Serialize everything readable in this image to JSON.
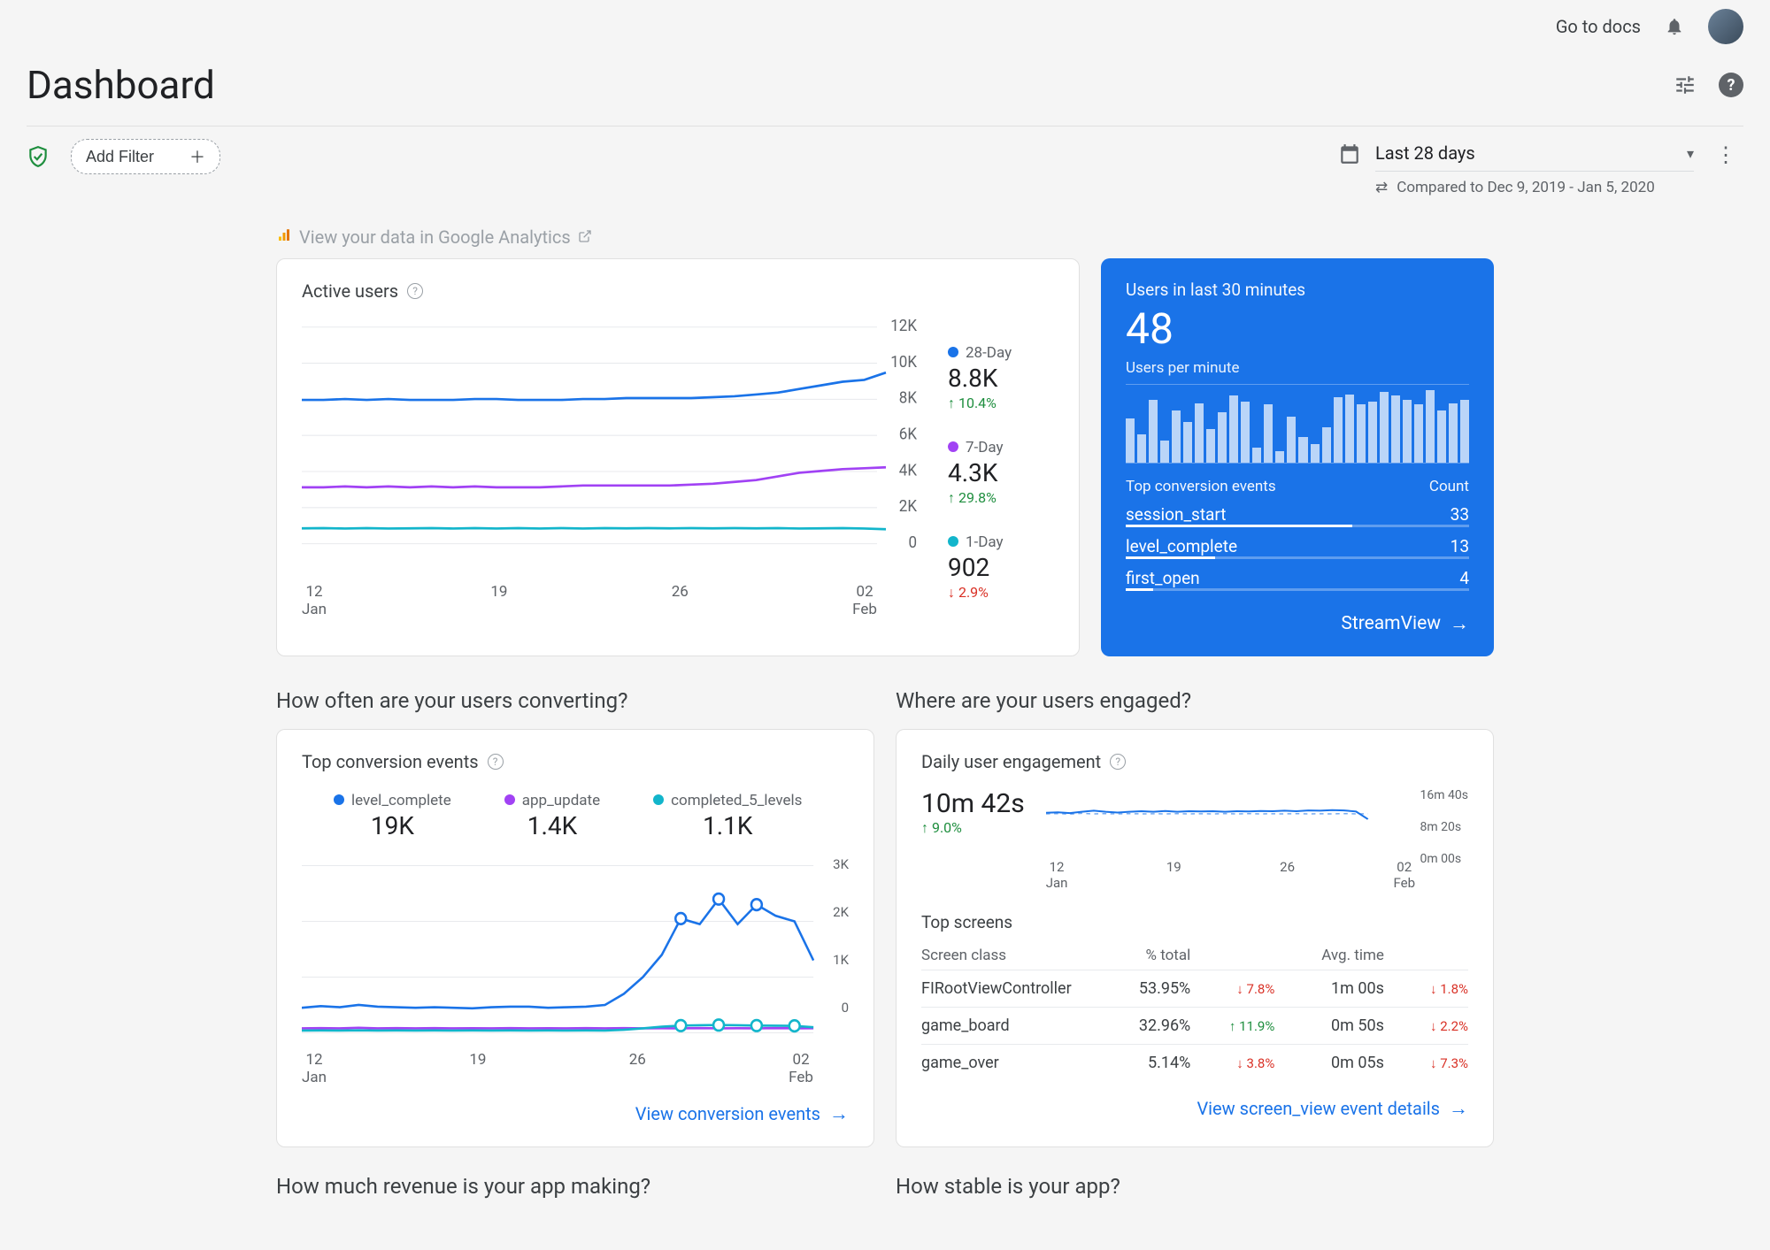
{
  "topbar": {
    "docs_link": "Go to docs"
  },
  "header": {
    "title": "Dashboard"
  },
  "filter": {
    "add_filter": "Add Filter"
  },
  "date": {
    "range": "Last 28 days",
    "compared": "Compared to Dec 9, 2019 - Jan 5, 2020"
  },
  "ga_link": "View your data in Google Analytics",
  "active_users": {
    "title": "Active users",
    "series": [
      {
        "label": "28-Day",
        "color": "#1a73e8",
        "value": "8.8K",
        "delta": "10.4%",
        "dir": "up"
      },
      {
        "label": "7-Day",
        "color": "#a142f4",
        "value": "4.3K",
        "delta": "29.8%",
        "dir": "up"
      },
      {
        "label": "1-Day",
        "color": "#12b5cb",
        "value": "902",
        "delta": "2.9%",
        "dir": "down"
      }
    ],
    "y_ticks": [
      "12K",
      "10K",
      "8K",
      "6K",
      "4K",
      "2K",
      "0"
    ],
    "x_ticks": [
      {
        "top": "12",
        "bot": "Jan"
      },
      {
        "top": "19",
        "bot": ""
      },
      {
        "top": "26",
        "bot": ""
      },
      {
        "top": "02",
        "bot": "Feb"
      }
    ]
  },
  "chart_data": [
    {
      "id": "active_users",
      "type": "line",
      "title": "Active users",
      "xlabel": "",
      "ylabel": "",
      "ylim": [
        0,
        12000
      ],
      "x_ticks": [
        "12 Jan",
        "19",
        "26",
        "02 Feb"
      ],
      "series": [
        {
          "name": "28-Day",
          "color": "#1a73e8",
          "values": [
            8000,
            8000,
            8050,
            8000,
            8050,
            8000,
            8000,
            8000,
            8050,
            8050,
            8000,
            8000,
            8000,
            8050,
            8050,
            8100,
            8100,
            8100,
            8100,
            8150,
            8200,
            8300,
            8400,
            8600,
            8800,
            9000,
            9100,
            9500
          ]
        },
        {
          "name": "7-Day",
          "color": "#a142f4",
          "values": [
            3200,
            3200,
            3250,
            3200,
            3250,
            3200,
            3250,
            3200,
            3250,
            3200,
            3200,
            3200,
            3250,
            3300,
            3300,
            3300,
            3300,
            3300,
            3350,
            3400,
            3500,
            3600,
            3800,
            4000,
            4100,
            4200,
            4250,
            4300
          ]
        },
        {
          "name": "1-Day",
          "color": "#12b5cb",
          "values": [
            950,
            960,
            940,
            960,
            940,
            950,
            960,
            940,
            960,
            940,
            960,
            940,
            960,
            940,
            960,
            950,
            960,
            950,
            960,
            950,
            960,
            950,
            960,
            940,
            950,
            960,
            940,
            900
          ]
        }
      ]
    },
    {
      "id": "users_per_minute",
      "type": "bar",
      "title": "Users per minute",
      "values": [
        60,
        38,
        85,
        30,
        70,
        55,
        80,
        45,
        68,
        90,
        82,
        20,
        78,
        15,
        62,
        35,
        25,
        48,
        88,
        92,
        78,
        82,
        95,
        90,
        85,
        78,
        98,
        70,
        80,
        85
      ],
      "ylim": [
        0,
        100
      ]
    },
    {
      "id": "top_conversion_events_timeseries",
      "type": "line",
      "title": "Top conversion events",
      "ylim": [
        0,
        3000
      ],
      "x_ticks": [
        "12 Jan",
        "19",
        "26",
        "02 Feb"
      ],
      "series": [
        {
          "name": "level_complete",
          "color": "#1a73e8",
          "values": [
            450,
            480,
            460,
            500,
            470,
            460,
            450,
            460,
            450,
            440,
            460,
            470,
            470,
            450,
            460,
            470,
            500,
            700,
            1000,
            1400,
            2050,
            1950,
            2400,
            1950,
            2300,
            2100,
            2000,
            1300
          ]
        },
        {
          "name": "app_update",
          "color": "#a142f4",
          "values": [
            80,
            85,
            80,
            90,
            80,
            85,
            80,
            85,
            80,
            82,
            80,
            85,
            80,
            83,
            80,
            85,
            80,
            85,
            80,
            82,
            80,
            85,
            80,
            82,
            80,
            85,
            80,
            82
          ]
        },
        {
          "name": "completed_5_levels",
          "color": "#12b5cb",
          "values": [
            40,
            42,
            40,
            45,
            40,
            42,
            40,
            43,
            40,
            42,
            40,
            43,
            40,
            42,
            40,
            43,
            40,
            55,
            80,
            110,
            130,
            135,
            140,
            135,
            130,
            128,
            125,
            100
          ]
        }
      ],
      "y_ticks": [
        "3K",
        "2K",
        "1K",
        "0"
      ]
    },
    {
      "id": "daily_user_engagement",
      "type": "line",
      "title": "Daily user engagement",
      "y_ticks": [
        "16m 40s",
        "8m 20s",
        "0m 00s"
      ],
      "x_ticks": [
        "12 Jan",
        "19",
        "26",
        "02 Feb"
      ],
      "series": [
        {
          "name": "current",
          "style": "solid",
          "values_seconds": [
            620,
            630,
            615,
            640,
            660,
            640,
            625,
            640,
            650,
            640,
            655,
            640,
            650,
            645,
            650,
            640,
            650,
            645,
            655,
            650,
            660,
            650,
            665,
            660,
            670,
            665,
            645,
            500
          ]
        },
        {
          "name": "previous",
          "style": "dashed",
          "values_seconds": [
            600,
            605,
            595,
            610,
            600,
            605,
            600,
            605,
            600,
            602,
            600,
            605,
            600,
            603,
            600,
            605,
            600,
            605,
            600,
            602,
            600,
            605,
            600,
            602,
            600,
            605,
            600,
            602
          ]
        }
      ]
    }
  ],
  "realtime": {
    "title": "Users in last 30 minutes",
    "count": "48",
    "sub": "Users per minute",
    "table_head": {
      "left": "Top conversion events",
      "right": "Count"
    },
    "rows": [
      {
        "name": "session_start",
        "count": "33",
        "pct": 66
      },
      {
        "name": "level_complete",
        "count": "13",
        "pct": 26
      },
      {
        "name": "first_open",
        "count": "4",
        "pct": 8
      }
    ],
    "link": "StreamView"
  },
  "sections": {
    "converting": "How often are your users converting?",
    "engaged": "Where are your users engaged?",
    "revenue": "How much revenue is your app making?",
    "stable": "How stable is your app?"
  },
  "conversion": {
    "title": "Top conversion events",
    "items": [
      {
        "label": "level_complete",
        "color": "#1a73e8",
        "value": "19K"
      },
      {
        "label": "app_update",
        "color": "#a142f4",
        "value": "1.4K"
      },
      {
        "label": "completed_5_levels",
        "color": "#12b5cb",
        "value": "1.1K"
      }
    ],
    "y_ticks": [
      "3K",
      "2K",
      "1K",
      "0"
    ],
    "x_ticks": [
      {
        "top": "12",
        "bot": "Jan"
      },
      {
        "top": "19",
        "bot": ""
      },
      {
        "top": "26",
        "bot": ""
      },
      {
        "top": "02",
        "bot": "Feb"
      }
    ],
    "link": "View conversion events"
  },
  "engagement": {
    "title": "Daily user engagement",
    "value": "10m 42s",
    "delta": "9.0%",
    "y_ticks": [
      "16m 40s",
      "8m 20s",
      "0m 00s"
    ],
    "x_ticks": [
      {
        "top": "12",
        "bot": "Jan"
      },
      {
        "top": "19",
        "bot": ""
      },
      {
        "top": "26",
        "bot": ""
      },
      {
        "top": "02",
        "bot": "Feb"
      }
    ],
    "table_title": "Top screens",
    "headers": {
      "c1": "Screen class",
      "c2": "% total",
      "c4": "Avg. time"
    },
    "rows": [
      {
        "name": "FIRootViewController",
        "pct": "53.95%",
        "pct_delta": "7.8%",
        "pct_dir": "down",
        "time": "1m 00s",
        "time_delta": "1.8%",
        "time_dir": "down"
      },
      {
        "name": "game_board",
        "pct": "32.96%",
        "pct_delta": "11.9%",
        "pct_dir": "up",
        "time": "0m 50s",
        "time_delta": "2.2%",
        "time_dir": "down"
      },
      {
        "name": "game_over",
        "pct": "5.14%",
        "pct_delta": "3.8%",
        "pct_dir": "down",
        "time": "0m 05s",
        "time_delta": "7.3%",
        "time_dir": "down"
      }
    ],
    "link": "View screen_view event details"
  }
}
